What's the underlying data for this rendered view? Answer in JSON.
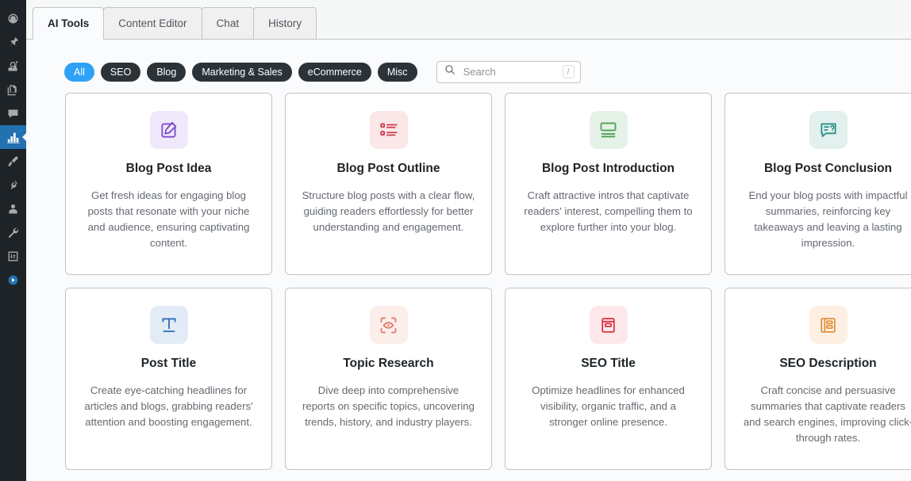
{
  "sidebar": {
    "items": [
      {
        "name": "dashboard",
        "icon": "dashboard-icon",
        "active": false
      },
      {
        "name": "posts",
        "icon": "pin-icon",
        "active": false
      },
      {
        "name": "media",
        "icon": "media-icon",
        "active": false
      },
      {
        "name": "pages",
        "icon": "pages-icon",
        "active": false
      },
      {
        "name": "comments",
        "icon": "comment-icon",
        "active": false
      },
      {
        "name": "ai-tools",
        "icon": "chart-icon",
        "active": true
      },
      {
        "name": "appearance",
        "icon": "brush-icon",
        "active": false
      },
      {
        "name": "plugins",
        "icon": "plug-icon",
        "active": false
      },
      {
        "name": "users",
        "icon": "user-icon",
        "active": false
      },
      {
        "name": "tools",
        "icon": "wrench-icon",
        "active": false
      },
      {
        "name": "settings",
        "icon": "settings-icon",
        "active": false
      },
      {
        "name": "player",
        "icon": "play-circle-icon",
        "active": false
      }
    ]
  },
  "tabs": [
    {
      "label": "AI Tools",
      "active": true
    },
    {
      "label": "Content Editor",
      "active": false
    },
    {
      "label": "Chat",
      "active": false
    },
    {
      "label": "History",
      "active": false
    }
  ],
  "filters": [
    {
      "label": "All",
      "active": true
    },
    {
      "label": "SEO",
      "active": false
    },
    {
      "label": "Blog",
      "active": false
    },
    {
      "label": "Marketing & Sales",
      "active": false
    },
    {
      "label": "eCommerce",
      "active": false
    },
    {
      "label": "Misc",
      "active": false
    }
  ],
  "search": {
    "placeholder": "Search",
    "value": "",
    "shortcut": "/"
  },
  "colors": {
    "accent_blue": "#2ea2f4",
    "pill_dark": "#2c3338",
    "admin_bg": "#1d2327",
    "admin_active": "#2271b1",
    "page_bg": "#fafbfc",
    "card_border": "#c3c4c7",
    "title": "#1d2327",
    "desc": "#646970"
  },
  "cards": [
    {
      "title": "Blog Post Idea",
      "desc": "Get fresh ideas for engaging blog posts that resonate with your niche and audience, ensuring captivating content.",
      "icon": "edit-square-icon",
      "icon_color": "#7c4dcc",
      "icon_bg": "#f0e9fb"
    },
    {
      "title": "Blog Post Outline",
      "desc": "Structure blog posts with a clear flow, guiding readers effortlessly for better understanding and engagement.",
      "icon": "list-icon",
      "icon_color": "#c9414a",
      "icon_bg": "#fbe6e8"
    },
    {
      "title": "Blog Post Introduction",
      "desc": "Craft attractive intros that captivate readers' interest, compelling them to explore further into your blog.",
      "icon": "layout-header-icon",
      "icon_color": "#54a45e",
      "icon_bg": "#e6f2e7"
    },
    {
      "title": "Blog Post Conclusion",
      "desc": "End your blog posts with impactful summaries, reinforcing key takeaways and leaving a lasting impression.",
      "icon": "speech-bubble-question-icon",
      "icon_color": "#2a9187",
      "icon_bg": "#e2f0ee"
    },
    {
      "title": "Post Title",
      "desc": "Create eye-catching headlines for articles and blogs, grabbing readers' attention and boosting engagement.",
      "icon": "typography-t-icon",
      "icon_color": "#2f6fb5",
      "icon_bg": "#e2ebf6"
    },
    {
      "title": "Topic Research",
      "desc": "Dive deep into comprehensive reports on specific topics, uncovering trends, history, and industry players.",
      "icon": "eye-focus-icon",
      "icon_color": "#e08070",
      "icon_bg": "#fceeeb"
    },
    {
      "title": "SEO Title",
      "desc": "Optimize headlines for enhanced visibility, organic traffic, and a stronger online presence.",
      "icon": "card-window-icon",
      "icon_color": "#e0313d",
      "icon_bg": "#fce8ea"
    },
    {
      "title": "SEO Description",
      "desc": "Craft concise and persuasive summaries that captivate readers and search engines, improving click-through rates.",
      "icon": "document-layout-icon",
      "icon_color": "#e2903f",
      "icon_bg": "#fdf0e2"
    }
  ]
}
